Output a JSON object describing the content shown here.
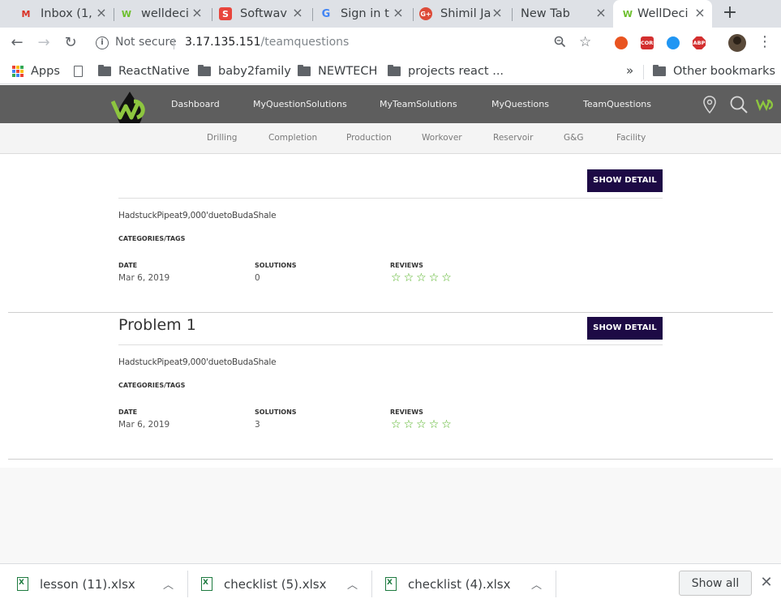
{
  "browser": {
    "tabs": [
      {
        "title": "Inbox (1,",
        "favicon": "gmail-icon"
      },
      {
        "title": "welldeci",
        "favicon": "welldecision-icon"
      },
      {
        "title": "Softwav",
        "favicon": "softwave-icon"
      },
      {
        "title": "Sign in t",
        "favicon": "google-icon"
      },
      {
        "title": "Shimil Ja",
        "favicon": "google-plus-icon"
      },
      {
        "title": "New Tab",
        "favicon": ""
      },
      {
        "title": "WellDeci",
        "favicon": "welldecision-icon"
      }
    ],
    "address": {
      "security": "Not secure",
      "host": "3.17.135.151",
      "path": "/teamquestions"
    },
    "extensions": [
      {
        "name": "ubuntu-extension-icon",
        "color": "#e95420",
        "text": ""
      },
      {
        "name": "cors-extension-icon",
        "color": "#d32f2f",
        "text": "CORS"
      },
      {
        "name": "info-extension-icon",
        "color": "#2196f3",
        "text": ""
      },
      {
        "name": "adblock-extension-icon",
        "color": "#d32f2f",
        "text": "ABP"
      }
    ],
    "bookmarks": {
      "apps": "Apps",
      "items": [
        "ReactNative",
        "baby2family",
        "NEWTECH",
        "projects react ..."
      ],
      "other": "Other bookmarks"
    }
  },
  "site": {
    "nav": [
      "Dashboard",
      "MyQuestionSolutions",
      "MyTeamSolutions",
      "MyQuestions",
      "TeamQuestions"
    ],
    "subnav": [
      "Drilling",
      "Completion",
      "Production",
      "Workover",
      "Reservoir",
      "G&G",
      "Facility"
    ],
    "colors": {
      "header": "#5e5e5e",
      "button": "#1d0a45",
      "star": "#4caf1a",
      "brand": "#8dc63f"
    }
  },
  "questions": [
    {
      "title": "",
      "button": "SHOW DETAIL",
      "description": "HadstuckPipeat9,000'duetoBudaShale",
      "tags_label": "CATEGORIES/TAGS",
      "date_label": "DATE",
      "date": "Mar 6, 2019",
      "solutions_label": "SOLUTIONS",
      "solutions": "0",
      "reviews_label": "REVIEWS",
      "rating": 0
    },
    {
      "title": "Problem 1",
      "button": "SHOW DETAIL",
      "description": "HadstuckPipeat9,000'duetoBudaShale",
      "tags_label": "CATEGORIES/TAGS",
      "date_label": "DATE",
      "date": "Mar 6, 2019",
      "solutions_label": "SOLUTIONS",
      "solutions": "3",
      "reviews_label": "REVIEWS",
      "rating": 0
    }
  ],
  "downloads": {
    "files": [
      "lesson (11).xlsx",
      "checklist (5).xlsx",
      "checklist (4).xlsx"
    ],
    "show_all": "Show all"
  }
}
